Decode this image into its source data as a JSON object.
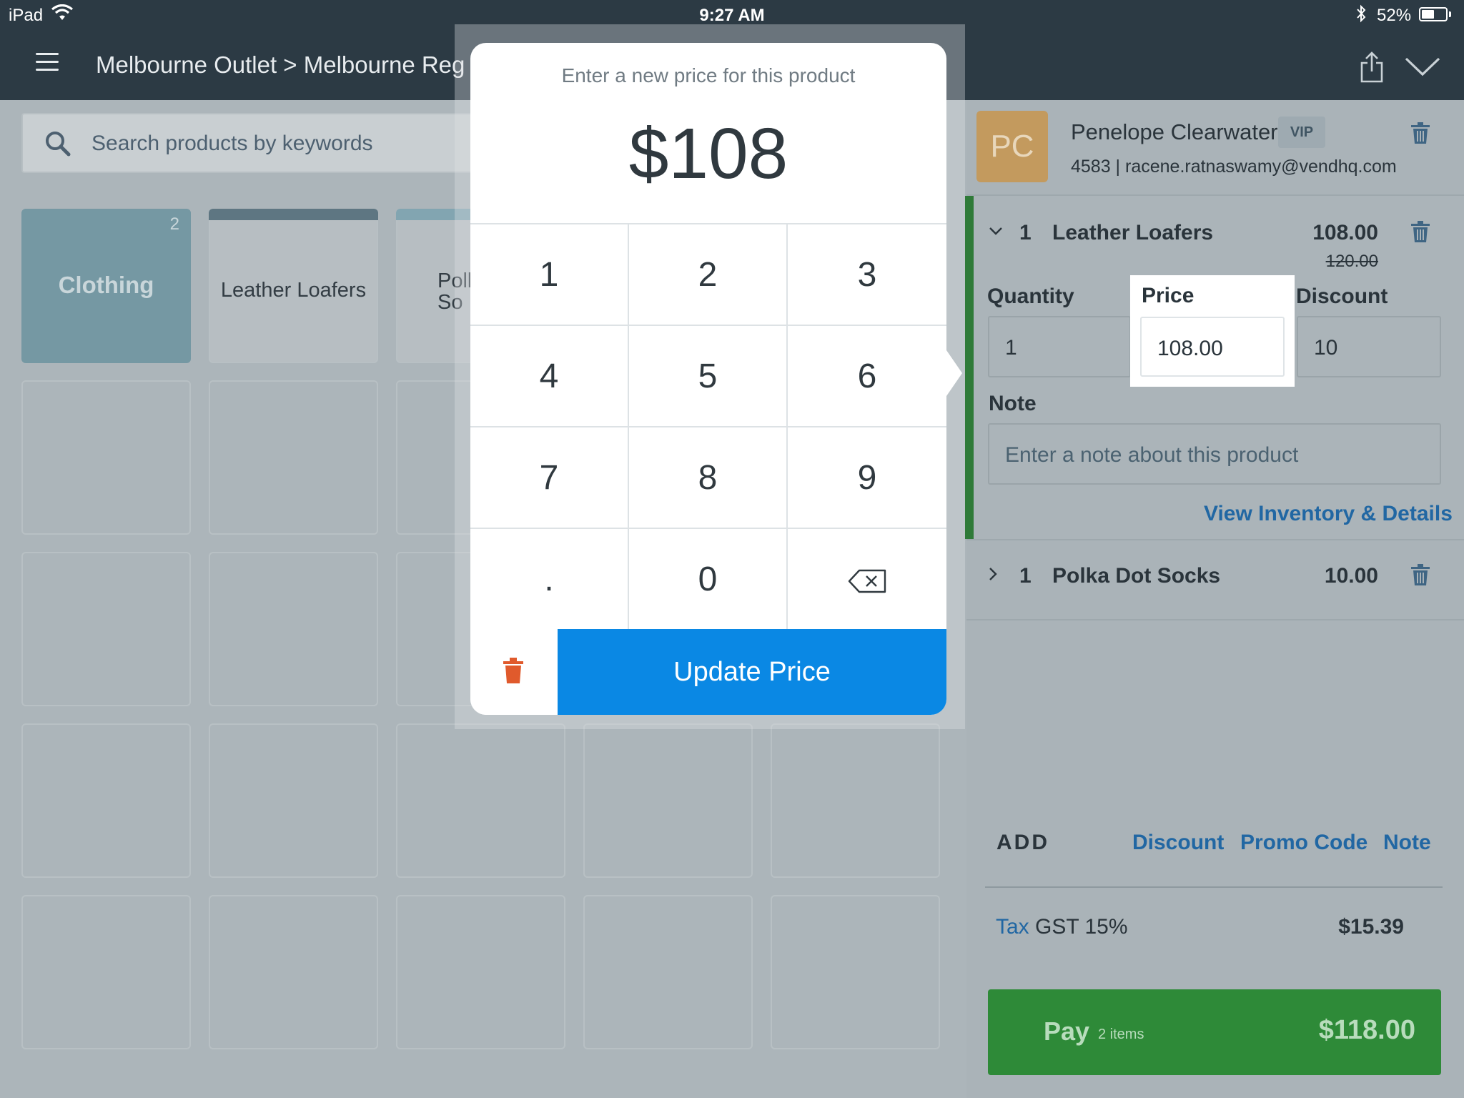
{
  "status_bar": {
    "device": "iPad",
    "time": "9:27 AM",
    "battery": "52%",
    "battery_level": 0.52,
    "icons": [
      "wifi-icon",
      "bluetooth-icon",
      "battery-icon"
    ]
  },
  "nav": {
    "breadcrumb": "Melbourne Outlet > Melbourne Reg",
    "icons": [
      "menu-icon",
      "share-icon",
      "chevron-down-icon"
    ]
  },
  "search": {
    "placeholder": "Search products by keywords"
  },
  "tiles": [
    {
      "label": "Clothing",
      "count": "2",
      "kind": "folder"
    },
    {
      "label": "Leather Loafers",
      "kind": "product"
    },
    {
      "label": "Poll \nSo",
      "kind": "product"
    }
  ],
  "customer": {
    "initials": "PC",
    "name": "Penelope  Clearwater",
    "badge": "VIP",
    "info": "4583 | racene.ratnaswamy@vendhq.com"
  },
  "line_items": [
    {
      "qty": "1",
      "name": "Leather Loafers",
      "price": "108.00",
      "original_price": "120.00",
      "expanded": true,
      "fields": {
        "quantity_label": "Quantity",
        "quantity_value": "1",
        "price_label": "Price",
        "price_value": "108.00",
        "discount_label": "Discount",
        "discount_value": "10",
        "note_label": "Note",
        "note_placeholder": "Enter a note about this product"
      },
      "details_link": "View Inventory & Details"
    },
    {
      "qty": "1",
      "name": "Polka Dot Socks",
      "price": "10.00",
      "expanded": false
    }
  ],
  "add_section": {
    "label": "ADD",
    "links": [
      "Discount",
      "Promo Code",
      "Note"
    ]
  },
  "tax": {
    "link": "Tax",
    "label": "GST 15%",
    "value": "$15.39"
  },
  "pay": {
    "label": "Pay",
    "items": "2 items",
    "amount": "$118.00"
  },
  "price_modal": {
    "prompt": "Enter a new price for this product",
    "display": "$108",
    "keys": [
      "1",
      "2",
      "3",
      "4",
      "5",
      "6",
      "7",
      "8",
      "9",
      ".",
      "0"
    ],
    "backspace_icon": "backspace-icon",
    "delete_icon": "trash-icon",
    "submit_label": "Update Price"
  },
  "colors": {
    "nav_bg": "#2c3a44",
    "primary_blue": "#0a88e4",
    "pay_green": "#2e8a38",
    "delete_red": "#e05a2c",
    "link_blue": "#2167a3"
  }
}
